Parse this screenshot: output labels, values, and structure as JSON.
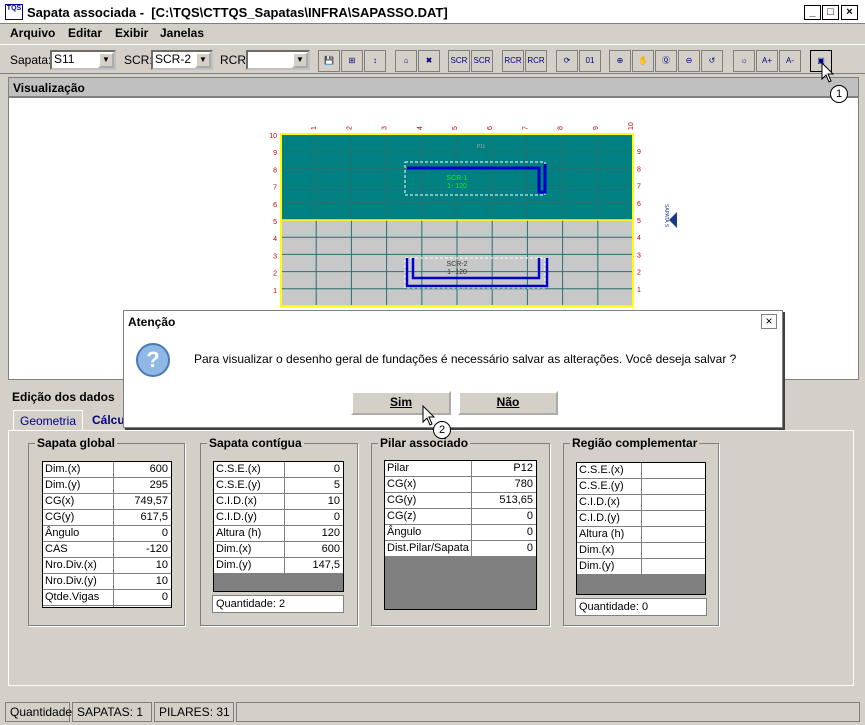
{
  "window": {
    "title": "Sapata associada -  [C:\\TQS\\CTTQS_Sapatas\\INFRA\\SAPASSO.DAT]",
    "logo": "TQS",
    "minimize": "_",
    "maximize": "□",
    "close": "×"
  },
  "menu": [
    "Arquivo",
    "Editar",
    "Exibir",
    "Janelas"
  ],
  "toolbar": {
    "sapata_label": "Sapata:",
    "sapata_value": "S11",
    "scr_label": "SCR:",
    "scr_value": "SCR-2",
    "rcr_label": "RCR:",
    "rcr_value": "",
    "buttons": [
      {
        "icon": "save-icon",
        "text": "💾"
      },
      {
        "icon": "calc-icon",
        "text": "⊞"
      },
      {
        "icon": "dimension-icon",
        "text": "↕"
      },
      {
        "icon": "sapata-icon",
        "text": "⌂"
      },
      {
        "icon": "delete-sapata-icon",
        "text": "✖"
      },
      {
        "icon": "add-scr-icon",
        "text": "SCR"
      },
      {
        "icon": "delete-scr-icon",
        "text": "SCR"
      },
      {
        "icon": "add-rcr-icon",
        "text": "RCR"
      },
      {
        "icon": "delete-rcr-icon",
        "text": "RCR"
      },
      {
        "icon": "redraw-icon",
        "text": "⟳"
      },
      {
        "icon": "number-icon",
        "text": "01"
      },
      {
        "icon": "zoom-window-icon",
        "text": "⊕"
      },
      {
        "icon": "pan-icon",
        "text": "✋"
      },
      {
        "icon": "zoom-all-icon",
        "text": "Ⓠ"
      },
      {
        "icon": "zoom-out-icon",
        "text": "⊖"
      },
      {
        "icon": "zoom-previous-icon",
        "text": "↺"
      },
      {
        "icon": "light-icon",
        "text": "☼"
      },
      {
        "icon": "font-increase-icon",
        "text": "A+"
      },
      {
        "icon": "font-decrease-icon",
        "text": "A-"
      },
      {
        "icon": "general-drawing-icon",
        "text": "▣"
      }
    ]
  },
  "visualizacao": {
    "header": "Visualização",
    "top_ticks": [
      "1",
      "2",
      "3",
      "4",
      "5",
      "6",
      "7",
      "8",
      "9",
      "10"
    ],
    "left_ticks": [
      "10",
      "9",
      "8",
      "7",
      "6",
      "5",
      "4",
      "3",
      "2",
      "1"
    ],
    "right_ticks": [
      "9",
      "8",
      "7",
      "6",
      "5",
      "4",
      "3",
      "2",
      "1"
    ],
    "scr1_label": "SCR-1",
    "scr1_sub": "1- 120",
    "scr2_label": "SCR-2",
    "scr2_sub": "1- 120",
    "p_label": "P11",
    "side_label": "SAPATA S"
  },
  "dialog": {
    "title": "Atenção",
    "icon": "?",
    "message": "Para visualizar o desenho geral de fundações é necessário salvar as alterações. Você deseja salvar ?",
    "yes": "Sim",
    "no": "Não",
    "close": "×"
  },
  "edicao": {
    "header": "Edição dos dados",
    "tabs": [
      "Geometria",
      "Cálculo"
    ]
  },
  "sapata_global": {
    "title": "Sapata global",
    "rows": [
      {
        "label": "Dim.(x)",
        "value": "600"
      },
      {
        "label": "Dim.(y)",
        "value": "295"
      },
      {
        "label": "CG(x)",
        "value": "749,57"
      },
      {
        "label": "CG(y)",
        "value": "617,5"
      },
      {
        "label": "Ângulo",
        "value": "0"
      },
      {
        "label": "CAS",
        "value": "-120"
      },
      {
        "label": "Nro.Div.(x)",
        "value": "10"
      },
      {
        "label": "Nro.Div.(y)",
        "value": "10"
      },
      {
        "label": "Qtde.Vigas",
        "value": "0"
      }
    ]
  },
  "sapata_contigua": {
    "title": "Sapata contígua",
    "rows": [
      {
        "label": "C.S.E.(x)",
        "value": "0"
      },
      {
        "label": "C.S.E.(y)",
        "value": "5"
      },
      {
        "label": "C.I.D.(x)",
        "value": "10"
      },
      {
        "label": "C.I.D.(y)",
        "value": "0"
      },
      {
        "label": "Altura (h)",
        "value": "120"
      },
      {
        "label": "Dim.(x)",
        "value": "600"
      },
      {
        "label": "Dim.(y)",
        "value": "147,5"
      }
    ],
    "quantidade": "Quantidade: 2"
  },
  "pilar_associado": {
    "title": "Pilar associado",
    "rows": [
      {
        "label": "Pilar",
        "value": "P12"
      },
      {
        "label": "CG(x)",
        "value": "780"
      },
      {
        "label": "CG(y)",
        "value": "513,65"
      },
      {
        "label": "CG(z)",
        "value": "0"
      },
      {
        "label": "Ângulo",
        "value": "0"
      },
      {
        "label": "Dist.Pilar/Sapata",
        "value": "0"
      }
    ]
  },
  "regiao_complementar": {
    "title": "Região complementar",
    "rows": [
      {
        "label": "C.S.E.(x)",
        "value": ""
      },
      {
        "label": "C.S.E.(y)",
        "value": ""
      },
      {
        "label": "C.I.D.(x)",
        "value": ""
      },
      {
        "label": "C.I.D.(y)",
        "value": ""
      },
      {
        "label": "Altura (h)",
        "value": ""
      },
      {
        "label": "Dim.(x)",
        "value": ""
      },
      {
        "label": "Dim.(y)",
        "value": ""
      }
    ],
    "quantidade": "Quantidade: 0"
  },
  "status": {
    "quantidade": "Quantidade:",
    "sapatas": "SAPATAS: 1",
    "pilares": "PILARES: 31"
  },
  "callouts": [
    "1",
    "2"
  ],
  "colors": {
    "teal": "#008080",
    "grid_gray": "#c8c8c8",
    "yellow_border": "#ffff00",
    "blue": "#0000cc"
  }
}
